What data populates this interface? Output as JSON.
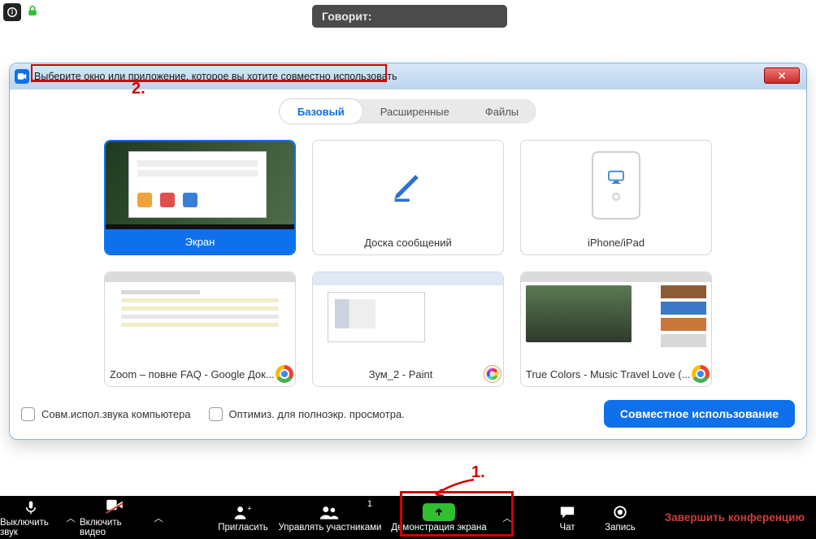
{
  "top": {
    "speaking_label": "Говорит:"
  },
  "dialog": {
    "title": "Выберите окно или приложение, которое вы хотите совместно использовать",
    "tabs": [
      "Базовый",
      "Расширенные",
      "Файлы"
    ],
    "tiles": [
      {
        "id": "screen",
        "label": "Экран",
        "selected": true
      },
      {
        "id": "whiteboard",
        "label": "Доска сообщений",
        "selected": false
      },
      {
        "id": "iphone-ipad",
        "label": "iPhone/iPad",
        "selected": false
      },
      {
        "id": "chrome-doc",
        "label": "Zoom – повне FAQ - Google Док...",
        "app_icon": "chrome",
        "selected": false
      },
      {
        "id": "paint",
        "label": "Зум_2 - Paint",
        "app_icon": "paint",
        "selected": false
      },
      {
        "id": "chrome-yt",
        "label": "True Colors - Music Travel Love (...",
        "app_icon": "chrome",
        "selected": false
      }
    ],
    "checkboxes": [
      "Совм.испол.звука компьютера",
      "Оптимиз. для полноэкр. просмотра."
    ],
    "share_button": "Совместное использование"
  },
  "toolbar": {
    "items": [
      {
        "id": "mute",
        "label": "Выключить звук"
      },
      {
        "id": "video",
        "label": "Включить видео"
      },
      {
        "id": "invite",
        "label": "Пригласить"
      },
      {
        "id": "participants",
        "label": "Управлять участниками",
        "badge": "1"
      },
      {
        "id": "share",
        "label": "Демонстрация экрана"
      },
      {
        "id": "chat",
        "label": "Чат"
      },
      {
        "id": "record",
        "label": "Запись"
      }
    ],
    "end_label": "Завершить конференцию"
  },
  "annotations": {
    "label1": "1.",
    "label2": "2.",
    "colors": {
      "highlight": "#d20000"
    }
  },
  "colors": {
    "accent": "#0e71eb",
    "share_green": "#2fbf2f",
    "danger": "#d23c3c"
  }
}
